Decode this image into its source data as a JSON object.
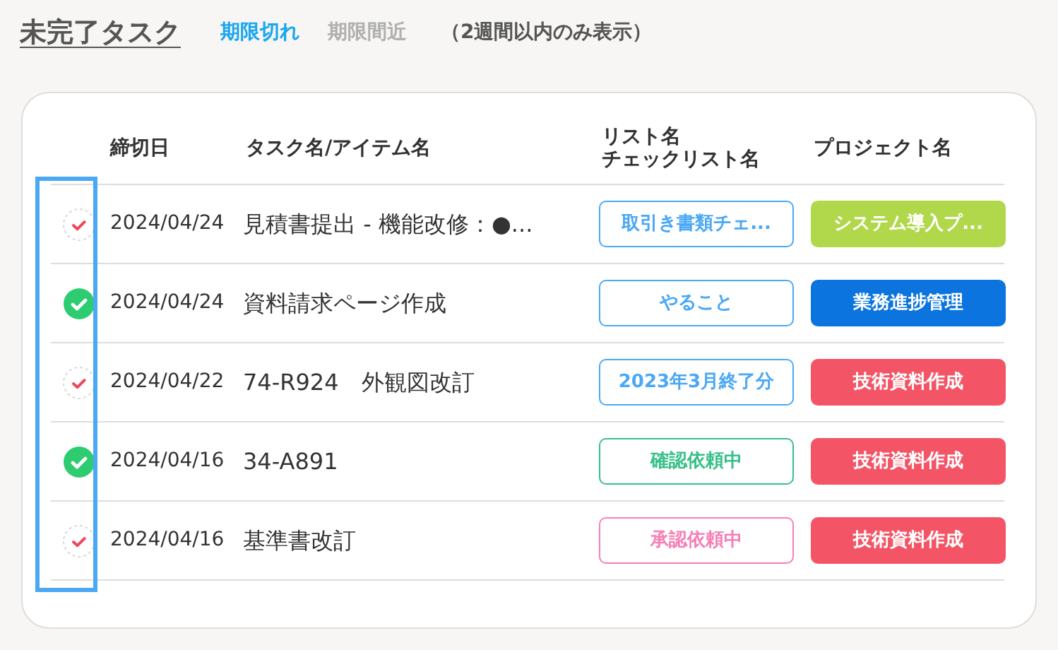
{
  "title": "未完了タスク",
  "tabs": [
    {
      "label": "期限切れ",
      "selected": true
    },
    {
      "label": "期限間近",
      "selected": false
    }
  ],
  "note": "（2週間以内のみ表示）",
  "table": {
    "columns": [
      {
        "lines": [
          "締切日"
        ]
      },
      {
        "lines": [
          "タスク名/アイテム名"
        ]
      },
      {
        "lines": [
          "リスト名",
          "チェックリスト名"
        ]
      },
      {
        "lines": [
          "プロジェクト名"
        ]
      }
    ],
    "rows": [
      {
        "done": false,
        "date": "2024/04/24",
        "task": "見積書提出 - 機能改修：●...",
        "list": {
          "label": "取引き書類チェ...",
          "color": "#4aa8f5"
        },
        "project": {
          "label": "システム導入プ...",
          "color": "#b0d84a"
        }
      },
      {
        "done": true,
        "date": "2024/04/24",
        "task": "資料請求ページ作成",
        "list": {
          "label": "やること",
          "color": "#4aa8f5"
        },
        "project": {
          "label": "業務進捗管理",
          "color": "#0b74de"
        }
      },
      {
        "done": false,
        "date": "2024/04/22",
        "task": "74-R924　外観図改訂",
        "list": {
          "label": "2023年3月終了分",
          "color": "#4aa8f5"
        },
        "project": {
          "label": "技術資料作成",
          "color": "#f45566"
        }
      },
      {
        "done": true,
        "date": "2024/04/16",
        "task": "34-A891",
        "list": {
          "label": "確認依頼中",
          "color": "#37c08a"
        },
        "project": {
          "label": "技術資料作成",
          "color": "#f45566"
        }
      },
      {
        "done": false,
        "date": "2024/04/16",
        "task": "基準書改訂",
        "list": {
          "label": "承認依頼中",
          "color": "#f77fb5"
        },
        "project": {
          "label": "技術資料作成",
          "color": "#f45566"
        }
      }
    ]
  }
}
